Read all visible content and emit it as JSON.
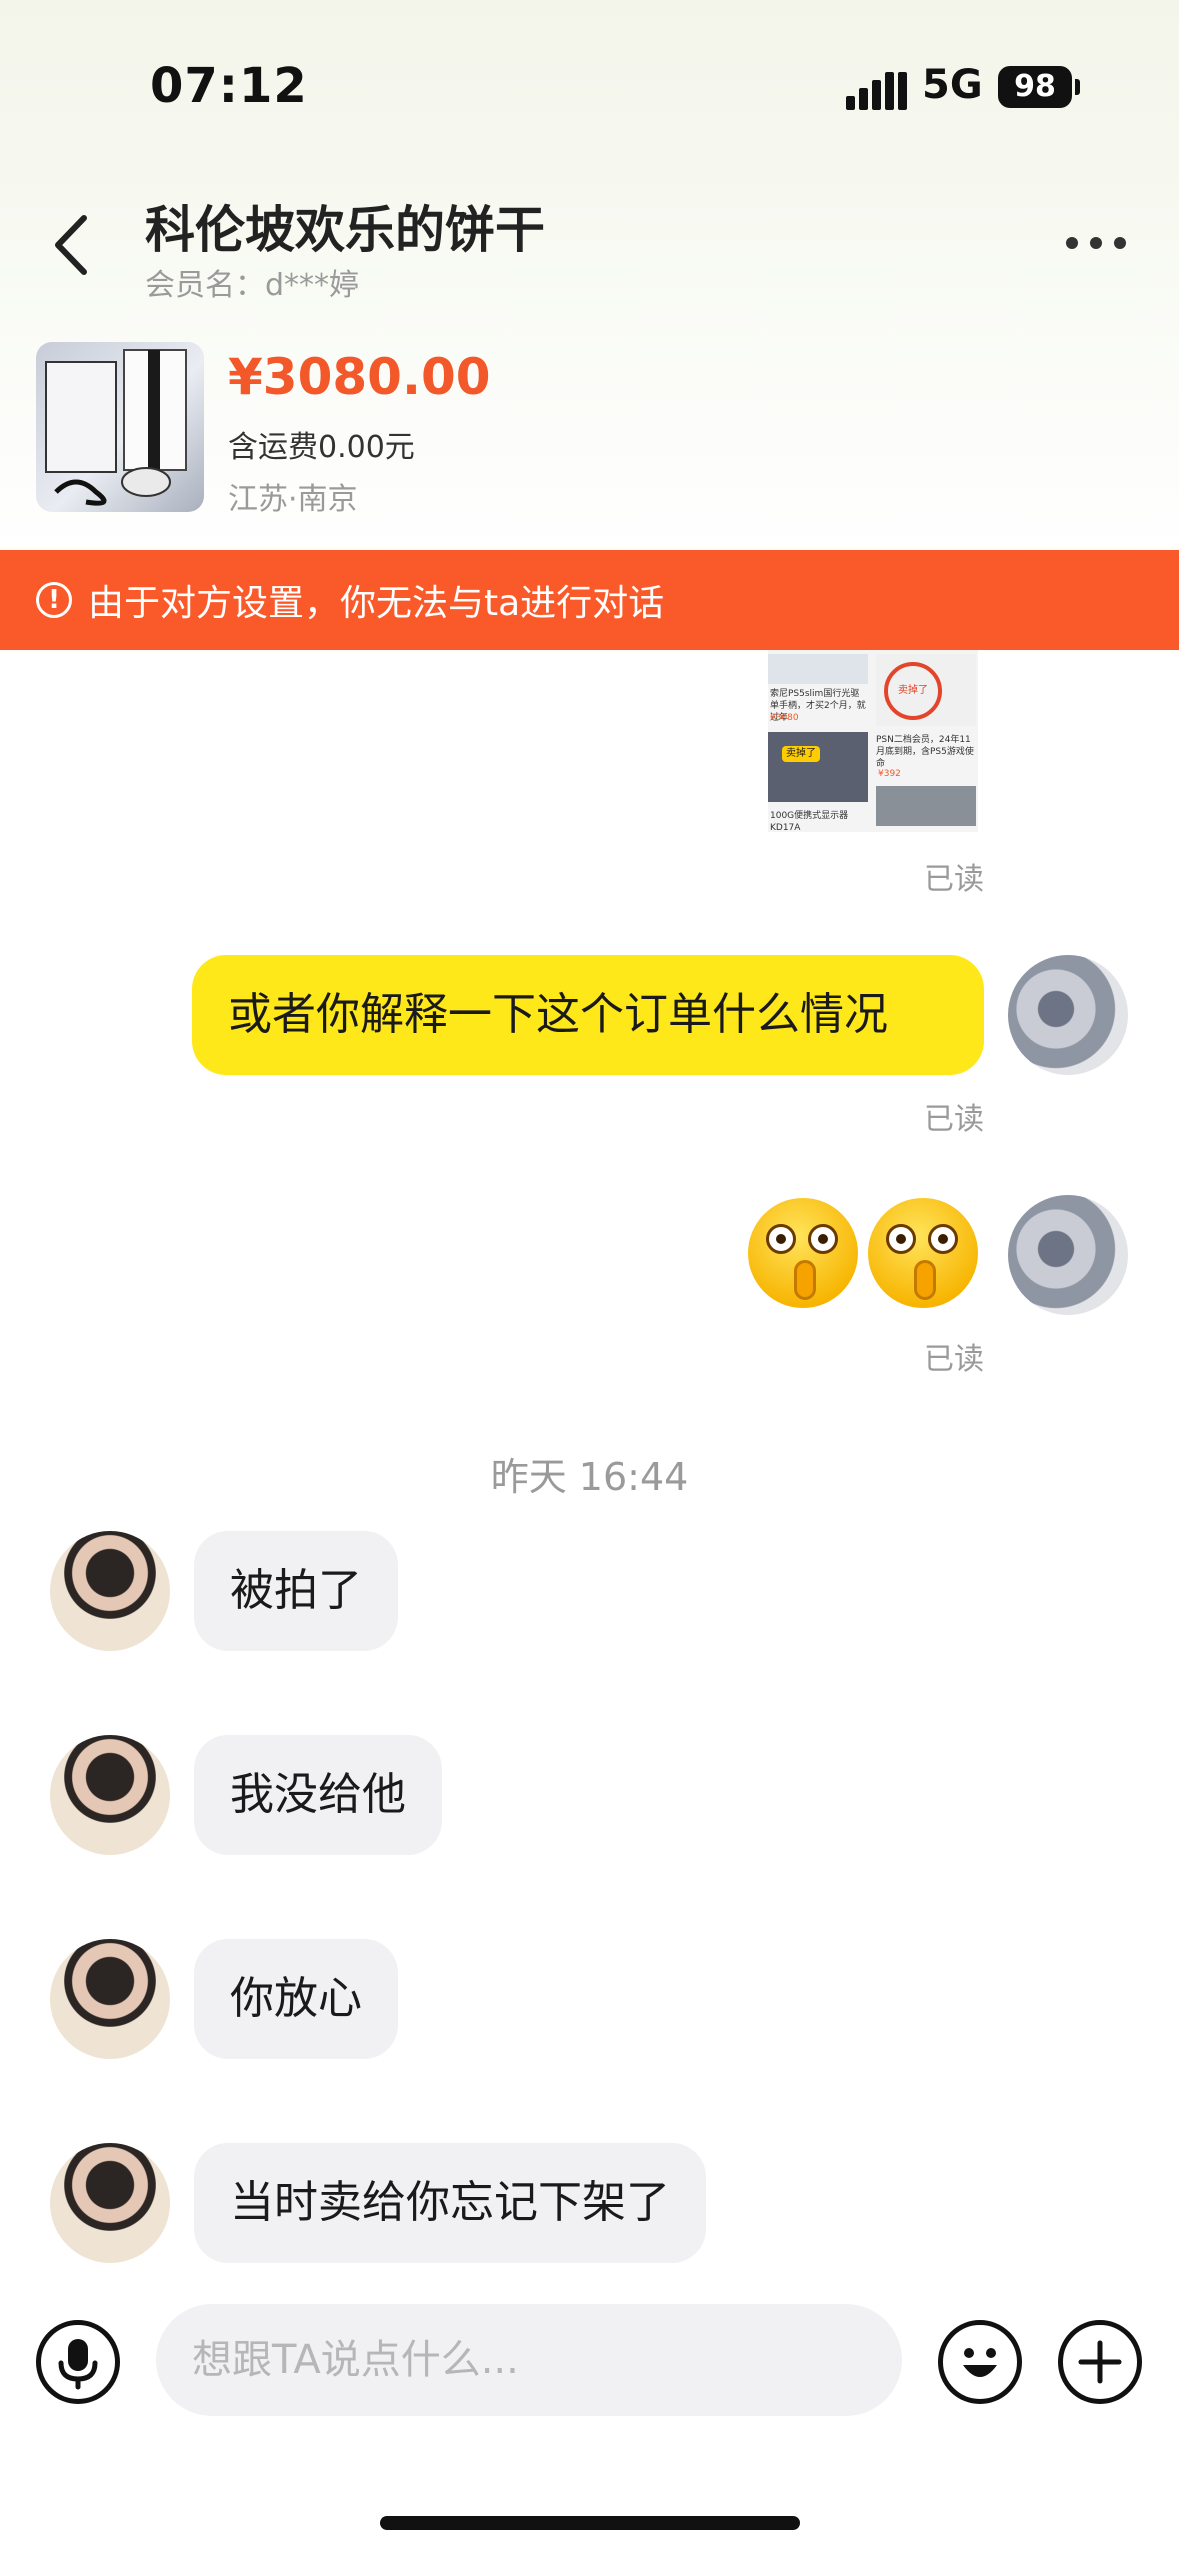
{
  "status_bar": {
    "time": "07:12",
    "network": "5G",
    "battery": "98"
  },
  "header": {
    "title": "科伦坡欢乐的饼干",
    "member": "会员名：d***婷"
  },
  "product": {
    "price": "¥3080.00",
    "shipping": "含运费0.00元",
    "location": "江苏·南京"
  },
  "banner": {
    "text": "由于对方设置，你无法与ta进行对话",
    "icon": "!"
  },
  "thumbnail": {
    "texts": [
      "索尼PS5slim国行光驱单手柄，才买2个月，就过年",
      "¥3080",
      "卖掉了",
      "PSN二档会员，24年11月底到期，含PS5游戏使命",
      "¥392",
      "卖掉了",
      "100G便携式显示器KD17A"
    ]
  },
  "messages": {
    "read_label": "已读",
    "me_text": "或者你解释一下这个订单什么情况",
    "timestamp": "昨天 16:44",
    "other": [
      "被拍了",
      "我没给他",
      "你放心",
      "当时卖给你忘记下架了"
    ]
  },
  "input_bar": {
    "placeholder": "想跟TA说点什么..."
  },
  "colors": {
    "price": "#f2582a",
    "banner": "#fa5a2a",
    "my_bubble": "#ffe81a",
    "other_bubble": "#f1f1f3"
  }
}
